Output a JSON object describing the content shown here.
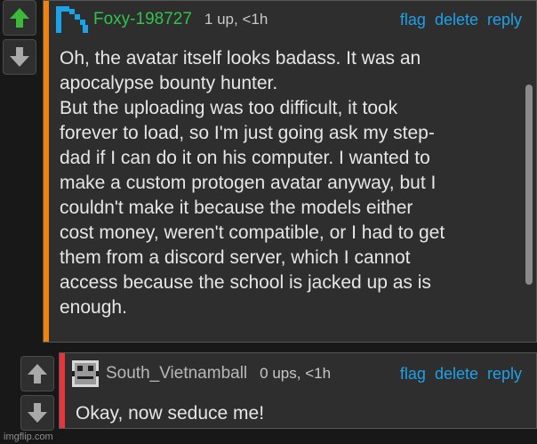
{
  "comment1": {
    "username": "Foxy-198727",
    "username_color": "#31c24c",
    "meta": "1 up, <1h",
    "actions": [
      "flag",
      "delete",
      "reply"
    ],
    "text": "Oh, the avatar itself looks badass. It was an\napocalypse bounty hunter.\nBut the uploading was too difficult, it took\nforever to load, so I'm just going ask my step-\ndad if I can do it on his computer. I wanted to\nmake a custom protogen avatar anyway, but I\ncouldn't make it because the models either\ncost money, weren't compatible, or I had to get\nthem from a discord server, which I cannot\naccess because the school is jacked up as is\nenough.",
    "stripe_color": "#f0820f",
    "avatar_icon": "pixel-fox-avatar-icon"
  },
  "comment2": {
    "username": "South_Vietnamball",
    "username_color": "#b8b8b8",
    "meta": "0 ups, <1h",
    "actions": [
      "flag",
      "delete",
      "reply"
    ],
    "text": "Okay, now seduce me!",
    "stripe_color": "#e8343a",
    "avatar_icon": "pixel-robot-avatar-icon"
  },
  "votes": {
    "upvote_active_color": "#3bb93b",
    "icon_color": "#a9a9a9"
  },
  "watermark": "imgflip.com"
}
